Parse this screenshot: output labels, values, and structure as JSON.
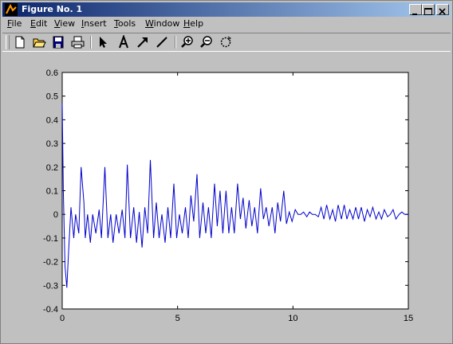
{
  "window": {
    "title": "Figure No. 1"
  },
  "menu": [
    {
      "label": "File",
      "underline": "F",
      "rest": "ile"
    },
    {
      "label": "Edit",
      "underline": "E",
      "rest": "dit"
    },
    {
      "label": "View",
      "underline": "V",
      "rest": "iew"
    },
    {
      "label": "Insert",
      "underline": "I",
      "rest": "nsert"
    },
    {
      "label": "Tools",
      "underline": "T",
      "rest": "ools"
    },
    {
      "label": "Window",
      "underline": "W",
      "rest": "indow"
    },
    {
      "label": "Help",
      "underline": "H",
      "rest": "elp"
    }
  ],
  "toolbar": [
    "new-file-icon",
    "open-folder-icon",
    "save-icon",
    "print-icon",
    "arrow-select-icon",
    "text-tool-icon",
    "arrow-tool-icon",
    "line-tool-icon",
    "zoom-in-icon",
    "zoom-out-icon",
    "rotate-icon"
  ],
  "colors": {
    "line": "#0000cc",
    "titlebar_start": "#0a246a",
    "titlebar_end": "#a6caf0"
  },
  "chart_data": {
    "type": "line",
    "title": "",
    "xlabel": "",
    "ylabel": "",
    "xlim": [
      0,
      15
    ],
    "ylim": [
      -0.4,
      0.6
    ],
    "xticks": [
      "0",
      "5",
      "10",
      "15"
    ],
    "yticks": [
      "-0.4",
      "-0.3",
      "-0.2",
      "-0.1",
      "0",
      "0.1",
      "0.2",
      "0.3",
      "0.4",
      "0.5",
      "0.6"
    ],
    "grid": false,
    "series": [
      {
        "color": "#0000cc",
        "x": [
          0,
          0.05,
          0.12,
          0.2,
          0.28,
          0.38,
          0.5,
          0.58,
          0.72,
          0.82,
          0.94,
          1.0,
          1.1,
          1.22,
          1.32,
          1.46,
          1.6,
          1.7,
          1.85,
          1.98,
          2.1,
          2.2,
          2.34,
          2.46,
          2.6,
          2.72,
          2.82,
          2.96,
          3.1,
          3.22,
          3.34,
          3.46,
          3.58,
          3.7,
          3.82,
          3.96,
          4.08,
          4.2,
          4.32,
          4.46,
          4.58,
          4.7,
          4.84,
          4.96,
          5.08,
          5.2,
          5.34,
          5.46,
          5.58,
          5.7,
          5.84,
          5.96,
          6.1,
          6.22,
          6.34,
          6.46,
          6.6,
          6.72,
          6.84,
          6.96,
          7.1,
          7.22,
          7.34,
          7.46,
          7.6,
          7.72,
          7.84,
          7.96,
          8.1,
          8.22,
          8.34,
          8.46,
          8.6,
          8.72,
          8.84,
          8.96,
          9.1,
          9.22,
          9.34,
          9.46,
          9.6,
          9.72,
          9.84,
          9.96,
          10.1,
          10.22,
          10.34,
          10.46,
          10.6,
          10.72,
          10.84,
          10.96,
          11.1,
          11.22,
          11.34,
          11.46,
          11.6,
          11.72,
          11.84,
          11.96,
          12.1,
          12.22,
          12.34,
          12.46,
          12.6,
          12.72,
          12.84,
          12.96,
          13.1,
          13.22,
          13.34,
          13.46,
          13.6,
          13.72,
          13.84,
          13.96,
          14.1,
          14.22,
          14.34,
          14.46,
          14.6,
          14.72,
          14.84,
          14.96,
          15.0
        ],
        "y": [
          0.47,
          0.1,
          -0.22,
          -0.31,
          -0.15,
          0.03,
          -0.1,
          0.0,
          -0.08,
          0.2,
          0.05,
          -0.1,
          0.0,
          -0.12,
          0.0,
          -0.08,
          0.02,
          -0.1,
          0.2,
          -0.1,
          0.0,
          -0.12,
          0.0,
          -0.08,
          0.02,
          -0.1,
          0.21,
          -0.1,
          0.03,
          -0.12,
          0.01,
          -0.14,
          0.03,
          -0.08,
          0.23,
          -0.1,
          0.05,
          -0.1,
          0.0,
          -0.12,
          0.03,
          -0.1,
          0.13,
          -0.1,
          0.0,
          -0.08,
          0.03,
          -0.1,
          0.08,
          -0.03,
          0.17,
          -0.1,
          0.05,
          -0.08,
          0.03,
          -0.1,
          0.13,
          -0.05,
          0.1,
          -0.08,
          0.1,
          -0.08,
          0.03,
          -0.08,
          0.13,
          -0.02,
          0.07,
          -0.06,
          0.06,
          -0.05,
          0.03,
          -0.08,
          0.11,
          -0.02,
          0.03,
          -0.05,
          0.03,
          -0.08,
          0.05,
          -0.03,
          0.1,
          -0.04,
          0.01,
          -0.03,
          0.02,
          0.0,
          0.0,
          0.01,
          -0.01,
          0.01,
          0.0,
          0.0,
          -0.01,
          0.03,
          -0.02,
          0.04,
          -0.02,
          0.02,
          -0.03,
          0.04,
          -0.02,
          0.04,
          -0.02,
          0.02,
          -0.02,
          0.03,
          -0.02,
          0.03,
          -0.03,
          0.02,
          -0.01,
          0.03,
          -0.02,
          0.01,
          -0.02,
          0.02,
          -0.01,
          0.0,
          0.02,
          -0.02,
          0.0,
          0.01,
          0.0,
          0.0,
          0.0
        ]
      }
    ]
  }
}
